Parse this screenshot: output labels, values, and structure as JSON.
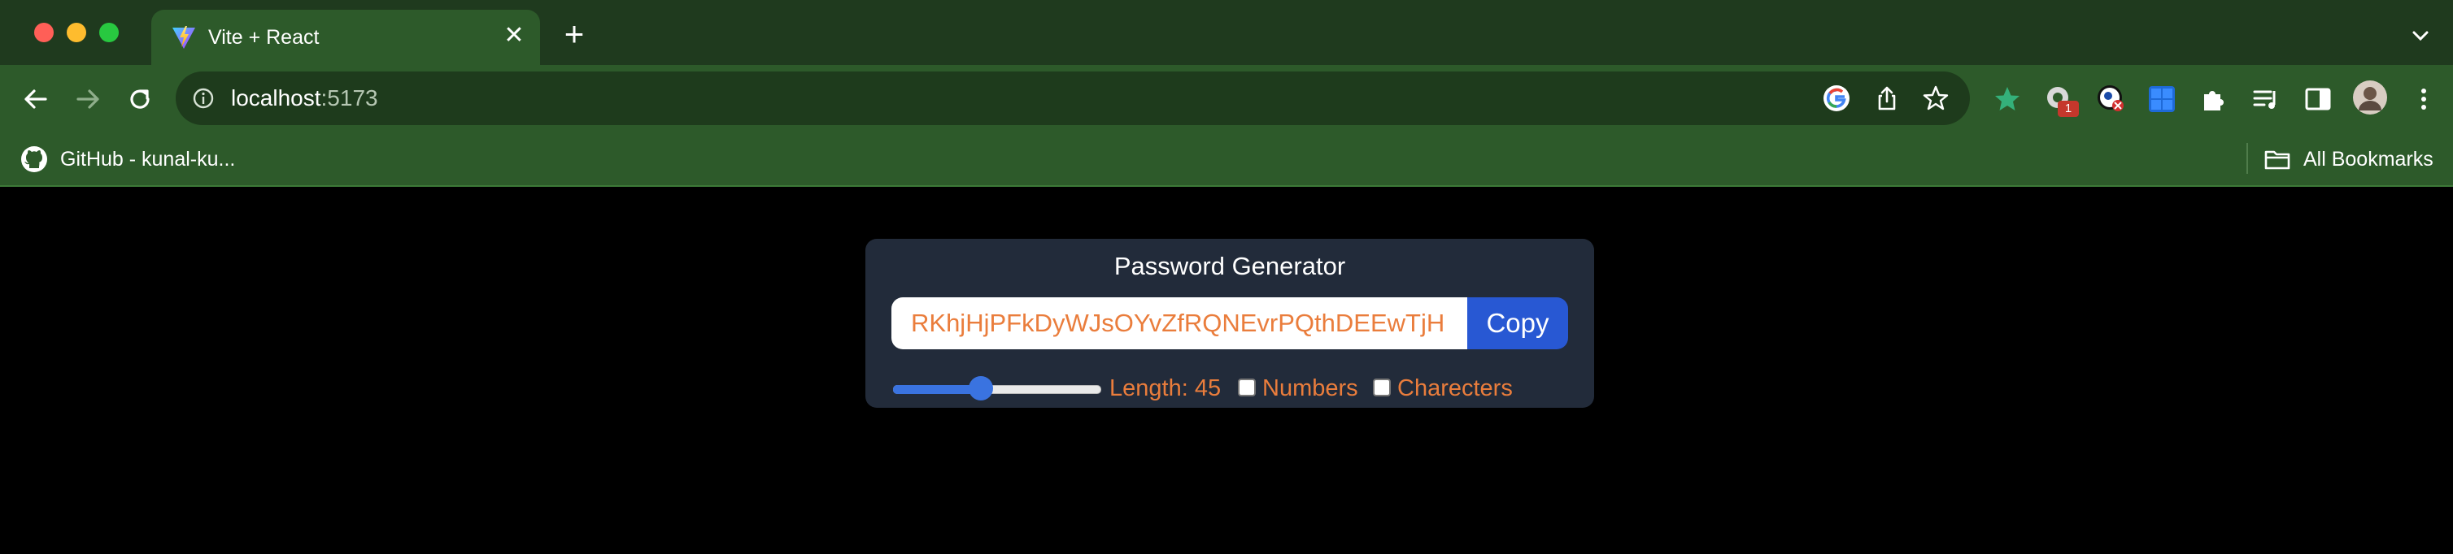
{
  "browser": {
    "tab": {
      "title": "Vite + React",
      "favicon": "vite-logo-icon"
    },
    "url": {
      "host": "localhost",
      "port": ":5173"
    },
    "bookmarks": [
      {
        "label": "GitHub - kunal-ku...",
        "icon": "github-icon"
      }
    ],
    "all_bookmarks_label": "All Bookmarks",
    "extension_badge": "1"
  },
  "app": {
    "title": "Password Generator",
    "password": "RKhjHjPFkDyWJsOYvZfRQNEvrPQthDEEwTjH",
    "copy_label": "Copy",
    "length": 45,
    "length_min": 6,
    "length_max": 100,
    "length_label": "Length: 45",
    "numbers_label": "Numbers",
    "numbers_checked": false,
    "characters_label": "Charecters",
    "characters_checked": false,
    "colors": {
      "accent_text": "#ea7d3c",
      "button": "#2858d3",
      "card": "#222b3a",
      "browser_frame": "#2d5a2a"
    }
  }
}
